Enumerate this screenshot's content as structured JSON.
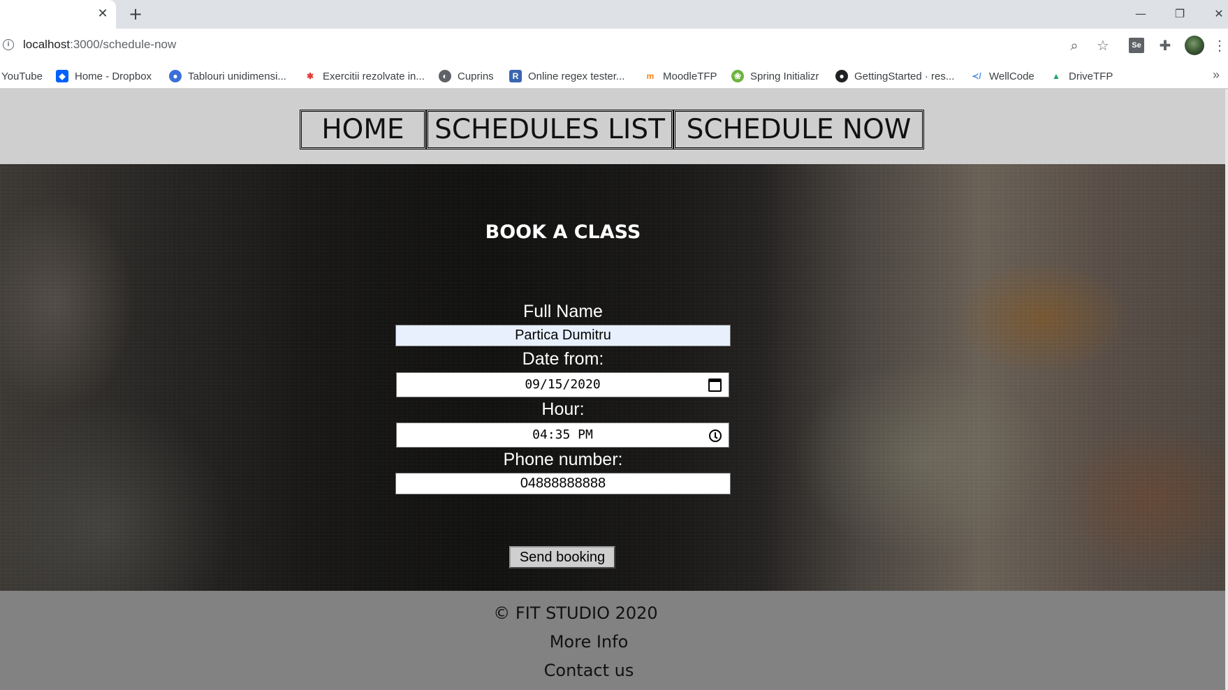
{
  "browser": {
    "tab_close": "✕",
    "new_tab": "+",
    "window_controls": [
      "—",
      "❐",
      "✕"
    ],
    "url_host": "localhost",
    "url_path": ":3000/schedule-now",
    "bookmarks": [
      {
        "label": "YouTube",
        "icon": "youtube-icon"
      },
      {
        "label": "Home - Dropbox",
        "icon": "dropbox-icon",
        "color": "#0061fe"
      },
      {
        "label": "Tablouri unidimensi...",
        "icon": "globe-icon",
        "color": "#3b6fd8"
      },
      {
        "label": "Exercitii rezolvate in...",
        "icon": "asterisk-icon",
        "color": "#e53935"
      },
      {
        "label": "Cuprins",
        "icon": "world-icon",
        "color": "#5f6368"
      },
      {
        "label": "Online regex tester...",
        "icon": "regex-icon",
        "color": "#3a66b0"
      },
      {
        "label": "MoodleTFP",
        "icon": "moodle-icon",
        "color": "#f98012"
      },
      {
        "label": "Spring Initializr",
        "icon": "spring-icon",
        "color": "#6db33f"
      },
      {
        "label": "GettingStarted · res...",
        "icon": "github-icon",
        "color": "#202124"
      },
      {
        "label": "WellCode",
        "icon": "wellcode-icon",
        "color": "#4a90e2"
      },
      {
        "label": "DriveTFP",
        "icon": "drive-icon",
        "color": "#1fa463"
      }
    ],
    "bookmarks_more": "»"
  },
  "nav": {
    "home": "HOME",
    "schedules_list": "SCHEDULES LIST",
    "schedule_now": "SCHEDULE NOW"
  },
  "form": {
    "title": "BOOK A CLASS",
    "full_name_label": "Full Name",
    "full_name_value": "Partica Dumitru",
    "date_label": "Date from:",
    "date_value": "09/15/2020",
    "hour_label": "Hour:",
    "hour_value": "04:35 PM",
    "phone_label": "Phone number:",
    "phone_value": "04888888888",
    "submit_label": "Send booking"
  },
  "footer": {
    "copyright": "© FIT STUDIO 2020",
    "more_info": "More Info",
    "contact": "Contact us"
  }
}
